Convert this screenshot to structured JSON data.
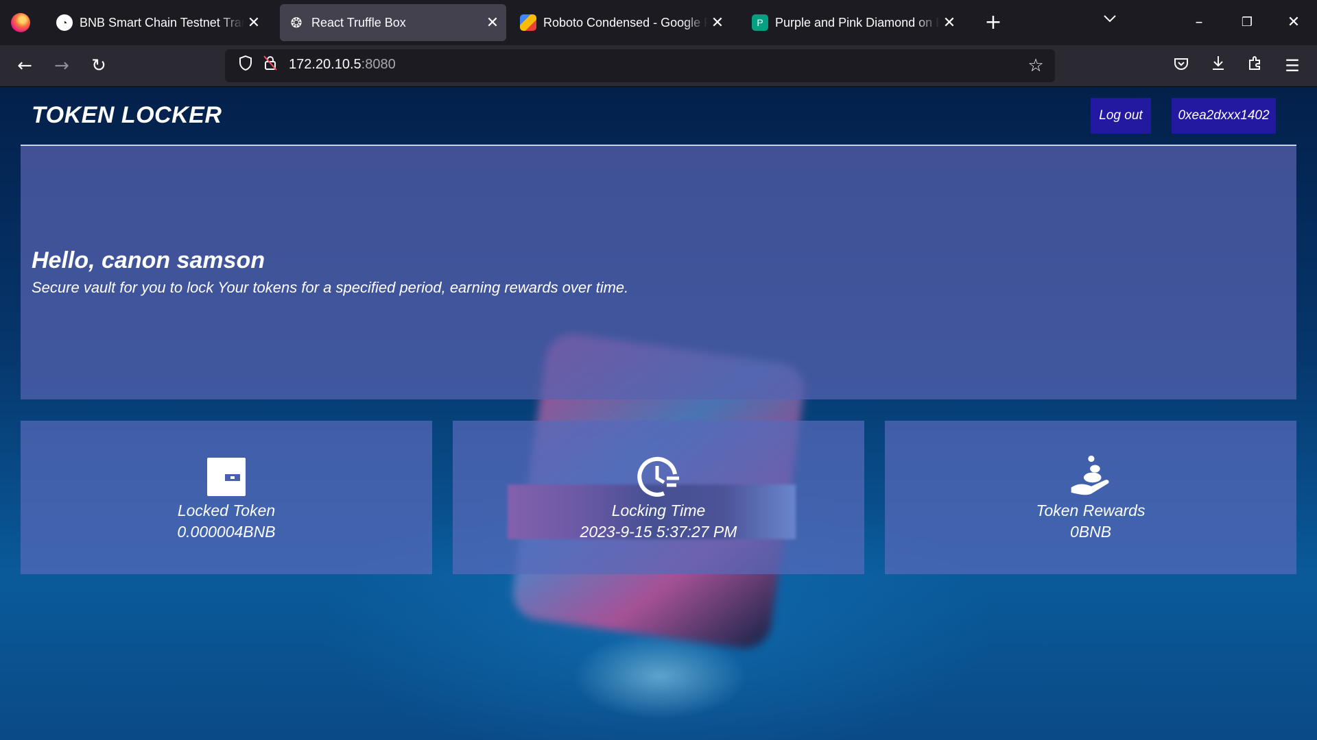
{
  "browser": {
    "tabs": [
      {
        "title": "BNB Smart Chain Testnet Transa",
        "favicon": "bscscan-icon",
        "active": false
      },
      {
        "title": "React Truffle Box",
        "favicon": "truffle-icon",
        "active": true
      },
      {
        "title": "Roboto Condensed - Google Fo",
        "favicon": "google-fonts-icon",
        "active": false
      },
      {
        "title": "Purple and Pink Diamond on Bl",
        "favicon": "pexels-icon",
        "active": false
      }
    ],
    "url_host": "172.20.10.5",
    "url_port": ":8080"
  },
  "app": {
    "brand": "TOKEN LOCKER",
    "logout_label": "Log out",
    "account_label": "0xea2dxxx1402",
    "greeting": "Hello, canon samson",
    "subtitle": "Secure vault for you to lock Your tokens for a specified period, earning rewards over time.",
    "cards": [
      {
        "label": "Locked Token",
        "value": "0.000004BNB",
        "icon": "wallet-icon"
      },
      {
        "label": "Locking Time",
        "value": "2023-9-15 5:37:27 PM",
        "icon": "clock-icon"
      },
      {
        "label": "Token Rewards",
        "value": "0BNB",
        "icon": "hand-coin-icon"
      }
    ]
  }
}
